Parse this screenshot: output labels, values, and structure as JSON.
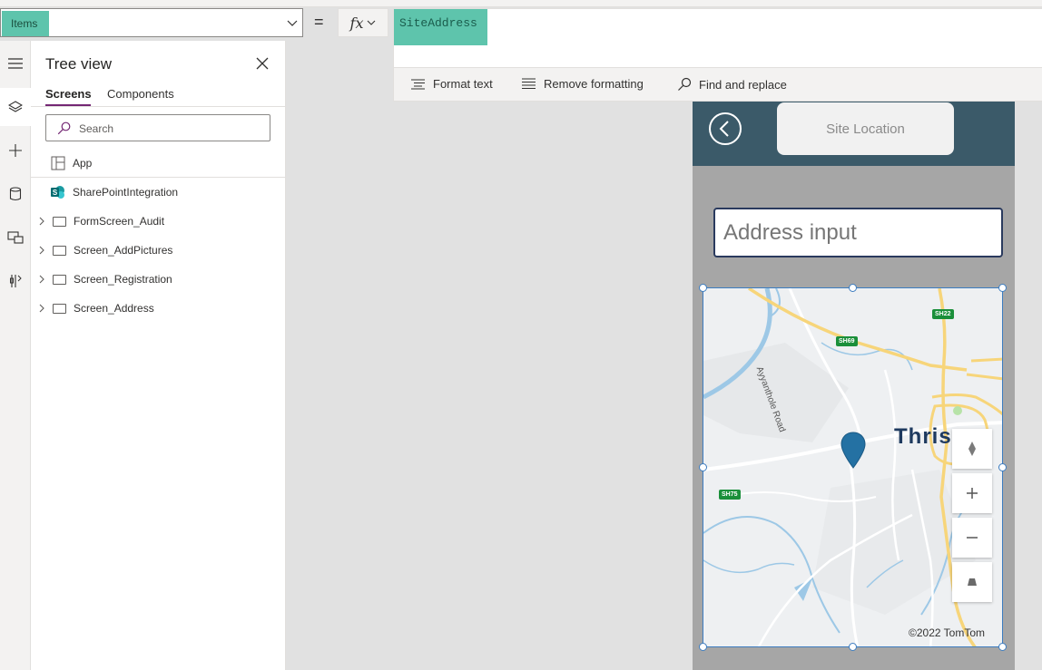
{
  "formula": {
    "property": "Items",
    "equals": "=",
    "fx_label": "fx",
    "value": "SiteAddress",
    "toolbar": {
      "format_text": "Format text",
      "remove_formatting": "Remove formatting",
      "find_replace": "Find and replace"
    }
  },
  "rail": {
    "icons": [
      "hamburger-icon",
      "layers-icon",
      "plus-icon",
      "database-icon",
      "media-icon",
      "tools-icon"
    ],
    "active_index": 1
  },
  "tree": {
    "title": "Tree view",
    "tabs": [
      "Screens",
      "Components"
    ],
    "active_tab": "Screens",
    "search_placeholder": "Search",
    "app_label": "App",
    "items": [
      {
        "label": "SharePointIntegration",
        "icon": "sharepoint-icon",
        "expandable": false
      },
      {
        "label": "FormScreen_Audit",
        "icon": "screen-icon",
        "expandable": true
      },
      {
        "label": "Screen_AddPictures",
        "icon": "screen-icon",
        "expandable": true
      },
      {
        "label": "Screen_Registration",
        "icon": "screen-icon",
        "expandable": true
      },
      {
        "label": "Screen_Address",
        "icon": "screen-icon",
        "expandable": true
      }
    ]
  },
  "screen": {
    "header_bg": "#3b5a69",
    "site_location_label": "Site Location",
    "address_placeholder": "Address input",
    "map": {
      "city_label": "Thris",
      "road_label": "Ayyanthole Road",
      "shields": [
        "SH22",
        "SH69",
        "SH75"
      ],
      "copyright": "©2022 TomTom",
      "controls": [
        "compass-icon",
        "zoom-in-icon",
        "zoom-out-icon",
        "tilt-icon"
      ]
    }
  },
  "colors": {
    "highlight": "#5ec4ac",
    "accent_purple": "#742774",
    "selection_blue": "#3c7cc0",
    "pin_blue": "#2471a3"
  }
}
